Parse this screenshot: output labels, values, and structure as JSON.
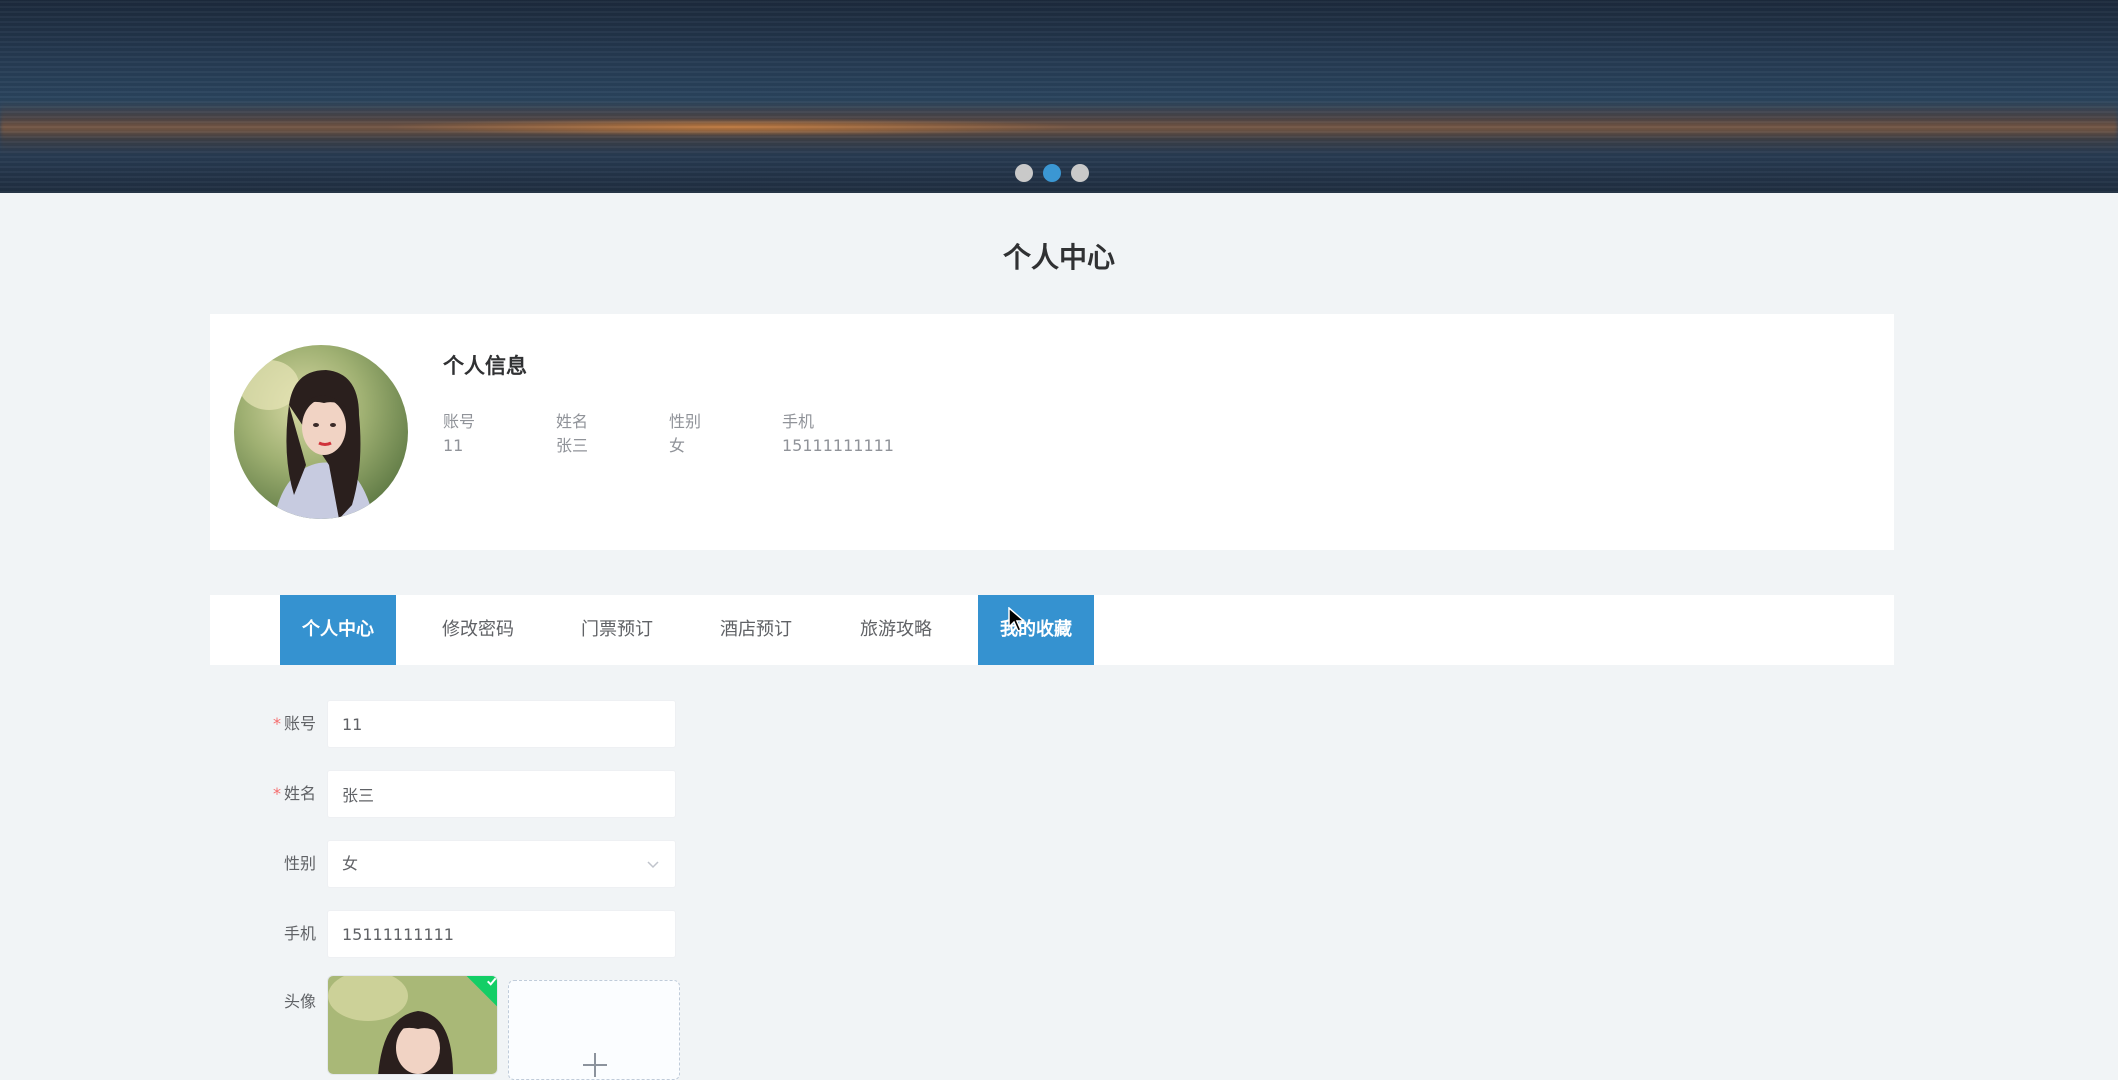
{
  "banner": {
    "carousel_dots": [
      {
        "label": "slide-1",
        "active": false
      },
      {
        "label": "slide-2",
        "active": true
      },
      {
        "label": "slide-3",
        "active": false
      }
    ]
  },
  "page": {
    "title": "个人中心"
  },
  "profile": {
    "title": "个人信息",
    "fields": [
      {
        "label": "账号",
        "value": "11"
      },
      {
        "label": "姓名",
        "value": "张三"
      },
      {
        "label": "性别",
        "value": "女"
      },
      {
        "label": "手机",
        "value": "15111111111"
      }
    ]
  },
  "tabs": [
    {
      "label": "个人中心",
      "active": true
    },
    {
      "label": "修改密码",
      "active": false
    },
    {
      "label": "门票预订",
      "active": false
    },
    {
      "label": "酒店预订",
      "active": false
    },
    {
      "label": "旅游攻略",
      "active": false
    },
    {
      "label": "我的收藏",
      "active": true
    }
  ],
  "form": {
    "account": {
      "label": "账号",
      "required": true,
      "value": "11"
    },
    "name": {
      "label": "姓名",
      "required": true,
      "value": "张三"
    },
    "gender": {
      "label": "性别",
      "required": false,
      "value": "女"
    },
    "phone": {
      "label": "手机",
      "required": false,
      "value": "15111111111"
    },
    "avatar": {
      "label": "头像",
      "required": false
    }
  },
  "colors": {
    "accent": "#3592d0",
    "page_bg": "#f1f4f6",
    "required": "#f56c6c",
    "success": "#13ce66"
  },
  "icons": [
    "chevron-down-icon",
    "plus-icon",
    "check-icon",
    "cursor-icon"
  ]
}
